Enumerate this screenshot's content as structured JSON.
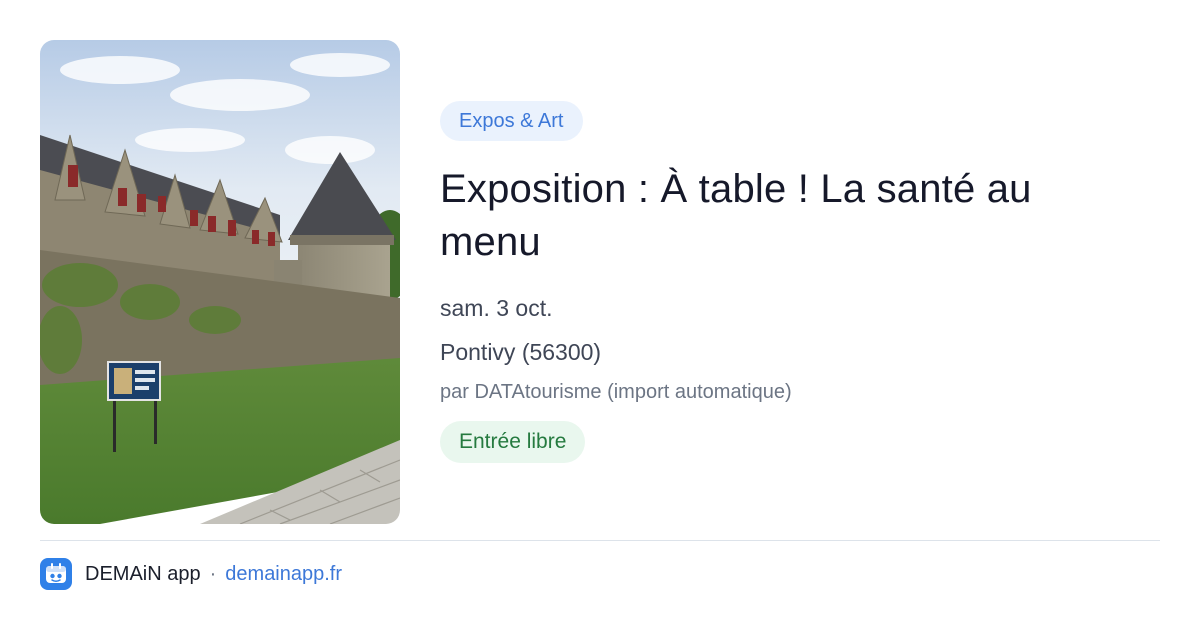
{
  "event": {
    "category": "Expos & Art",
    "title": "Exposition : À table ! La santé au menu",
    "date": "sam. 3 oct.",
    "location": "Pontivy (56300)",
    "source": "par DATAtourisme (import automatique)",
    "price_badge": "Entrée libre"
  },
  "footer": {
    "app_name": "DEMAiN app",
    "separator": "·",
    "domain": "demainapp.fr"
  },
  "colors": {
    "category_bg": "#eaf2fd",
    "category_text": "#3d78d8",
    "price_bg": "#e9f7ee",
    "price_text": "#257a3f",
    "brand_blue": "#2f80e8"
  },
  "icons": {
    "logo": "demain-app-logo-icon"
  }
}
